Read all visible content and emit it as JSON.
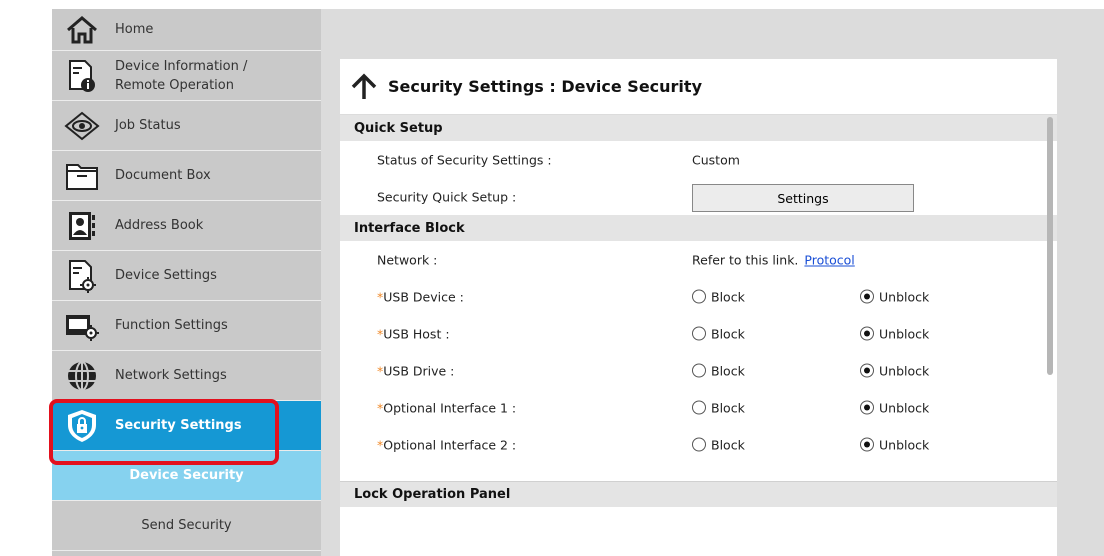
{
  "sidebar": {
    "items": [
      {
        "label": "Home",
        "icon": "home-icon"
      },
      {
        "label": "Device Information /\nRemote Operation",
        "icon": "device-info-icon"
      },
      {
        "label": "Job Status",
        "icon": "eye-icon"
      },
      {
        "label": "Document Box",
        "icon": "folder-icon"
      },
      {
        "label": "Address Book",
        "icon": "address-book-icon"
      },
      {
        "label": "Device Settings",
        "icon": "device-settings-icon"
      },
      {
        "label": "Function Settings",
        "icon": "function-settings-icon"
      },
      {
        "label": "Network Settings",
        "icon": "globe-icon"
      },
      {
        "label": "Security Settings",
        "icon": "shield-lock-icon"
      }
    ],
    "sub_items": [
      {
        "label": "Device Security"
      },
      {
        "label": "Send Security"
      }
    ]
  },
  "page": {
    "title": "Security Settings : Device Security"
  },
  "quick_setup": {
    "heading": "Quick Setup",
    "status_label": "Status of Security Settings :",
    "status_value": "Custom",
    "quick_setup_label": "Security Quick Setup :",
    "settings_button": "Settings"
  },
  "interface_block": {
    "heading": "Interface Block",
    "network_label": "Network :",
    "network_text": "Refer to this link.",
    "network_link": "Protocol",
    "block_label": "Block",
    "unblock_label": "Unblock",
    "rows": [
      {
        "label": "USB Device :",
        "selected": "Unblock"
      },
      {
        "label": "USB Host :",
        "selected": "Unblock"
      },
      {
        "label": "USB Drive :",
        "selected": "Unblock"
      },
      {
        "label": "Optional Interface 1 :",
        "selected": "Unblock"
      },
      {
        "label": "Optional Interface 2 :",
        "selected": "Unblock"
      }
    ]
  },
  "lock_panel": {
    "heading": "Lock Operation Panel"
  },
  "colors": {
    "active": "#1598d4",
    "active_sub": "#86d2ef",
    "highlight": "#e2101d",
    "required_mark": "#f08a2a"
  }
}
